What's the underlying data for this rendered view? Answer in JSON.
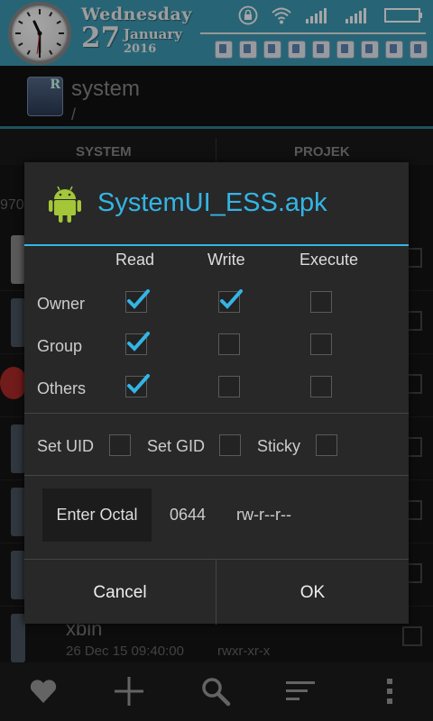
{
  "status_bar": {
    "day_name": "Wednesday",
    "day_number": "27",
    "month": "January",
    "year": "2016",
    "icons": [
      "lock-icon",
      "wifi-icon",
      "signal-icon",
      "signal-icon",
      "battery-icon"
    ],
    "notification_icons": [
      "chat-icon",
      "image-icon",
      "shield-icon",
      "download-icon",
      "download-icon",
      "download-icon",
      "download-icon",
      "download-icon",
      "download-icon"
    ]
  },
  "app_bar": {
    "title": "system",
    "path": "/"
  },
  "tabs": [
    "SYSTEM",
    "PROJEK"
  ],
  "background_list": {
    "size_fragment": "970",
    "last_item": {
      "name": "xbin",
      "date": "26 Dec 15 09:40:00",
      "permissions": "rwxr-xr-x"
    }
  },
  "dialog": {
    "title": "SystemUI_ESS.apk",
    "columns": [
      "Read",
      "Write",
      "Execute"
    ],
    "rows": [
      {
        "label": "Owner",
        "read": true,
        "write": true,
        "execute": false
      },
      {
        "label": "Group",
        "read": true,
        "write": false,
        "execute": false
      },
      {
        "label": "Others",
        "read": true,
        "write": false,
        "execute": false
      }
    ],
    "special": [
      {
        "label": "Set UID",
        "checked": false
      },
      {
        "label": "Set GID",
        "checked": false
      },
      {
        "label": "Sticky",
        "checked": false
      }
    ],
    "octal_button": "Enter Octal",
    "octal_value": "0644",
    "permission_string": "rw-r--r--",
    "cancel_label": "Cancel",
    "ok_label": "OK"
  },
  "toolbar": {
    "icons": [
      "favorite-icon",
      "add-icon",
      "search-icon",
      "sort-icon",
      "overflow-menu-icon"
    ]
  },
  "colors": {
    "accent": "#33b5e5",
    "status_bar": "#3d9cb6"
  }
}
